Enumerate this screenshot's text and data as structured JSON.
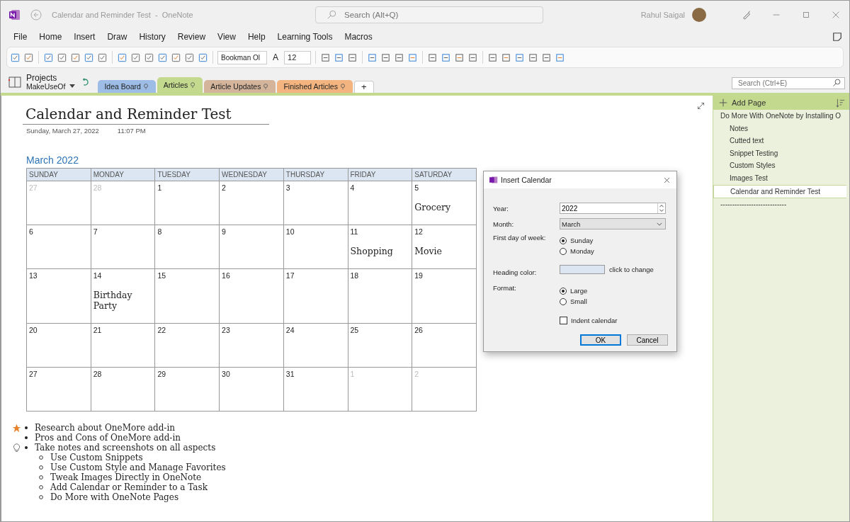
{
  "titlebar": {
    "title": "Calendar and Reminder Test  -  OneNote",
    "search_placeholder": "Search (Alt+Q)",
    "user": "Rahul Saigal"
  },
  "menu": [
    "File",
    "Home",
    "Insert",
    "Draw",
    "History",
    "Review",
    "View",
    "Help",
    "Learning Tools",
    "Macros"
  ],
  "toolbar": {
    "font": "Bookman Ol",
    "font_color_glyph": "A",
    "size": "12"
  },
  "notebook": {
    "group": "Projects",
    "name": "MakeUseOf"
  },
  "sections": [
    {
      "label": "Idea Board",
      "color": "#9dbde6",
      "selected": false
    },
    {
      "label": "Articles",
      "color": "#c3d98e",
      "selected": true
    },
    {
      "label": "Article Updates",
      "color": "#d4b59c",
      "selected": false
    },
    {
      "label": "Finished Articles",
      "color": "#f3b47f",
      "selected": false
    }
  ],
  "add_section": "+",
  "page_search": {
    "placeholder": "Search (Ctrl+E)"
  },
  "page": {
    "title": "Calendar and Reminder Test",
    "date": "Sunday, March 27, 2022",
    "time": "11:07 PM"
  },
  "calendar": {
    "heading": "March 2022",
    "weekdays": [
      "SUNDAY",
      "MONDAY",
      "TUESDAY",
      "WEDNESDAY",
      "THURSDAY",
      "FRIDAY",
      "SATURDAY"
    ],
    "weeks": [
      [
        {
          "day": "27",
          "outside": true
        },
        {
          "day": "28",
          "outside": true
        },
        {
          "day": "1",
          "outside": false
        },
        {
          "day": "2",
          "outside": false
        },
        {
          "day": "3",
          "outside": false
        },
        {
          "day": "4",
          "outside": false
        },
        {
          "day": "5",
          "outside": false,
          "event": "Grocery"
        }
      ],
      [
        {
          "day": "6",
          "outside": false
        },
        {
          "day": "7",
          "outside": false
        },
        {
          "day": "8",
          "outside": false
        },
        {
          "day": "9",
          "outside": false
        },
        {
          "day": "10",
          "outside": false
        },
        {
          "day": "11",
          "outside": false,
          "event": "Shopping"
        },
        {
          "day": "12",
          "outside": false,
          "event": "Movie"
        }
      ],
      [
        {
          "day": "13",
          "outside": false
        },
        {
          "day": "14",
          "outside": false,
          "event": "Birthday Party"
        },
        {
          "day": "15",
          "outside": false
        },
        {
          "day": "16",
          "outside": false
        },
        {
          "day": "17",
          "outside": false
        },
        {
          "day": "18",
          "outside": false
        },
        {
          "day": "19",
          "outside": false
        }
      ],
      [
        {
          "day": "20",
          "outside": false
        },
        {
          "day": "21",
          "outside": false
        },
        {
          "day": "22",
          "outside": false
        },
        {
          "day": "23",
          "outside": false
        },
        {
          "day": "24",
          "outside": false
        },
        {
          "day": "25",
          "outside": false
        },
        {
          "day": "26",
          "outside": false
        }
      ],
      [
        {
          "day": "27",
          "outside": false
        },
        {
          "day": "28",
          "outside": false
        },
        {
          "day": "29",
          "outside": false
        },
        {
          "day": "30",
          "outside": false
        },
        {
          "day": "31",
          "outside": false
        },
        {
          "day": "1",
          "outside": true
        },
        {
          "day": "2",
          "outside": true
        }
      ]
    ]
  },
  "notes": [
    {
      "text": "Research about OneMore add-in",
      "kind": "important"
    },
    {
      "text": "Pros and Cons of OneMore add-in",
      "kind": "plain"
    },
    {
      "text": "Take notes and screenshots on all aspects",
      "kind": "idea",
      "children": [
        {
          "text": "Use Custom Snippets"
        },
        {
          "text": "Use Custom Style and Manage Favorites"
        },
        {
          "text": "Tweak Images Directly in OneNote"
        },
        {
          "text": "Add Calendar or Reminder to a Task"
        },
        {
          "text": "Do More with OneNote Pages"
        }
      ]
    }
  ],
  "pages_pane": {
    "add_label": "Add Page",
    "pages": [
      {
        "title": "Do More With OneNote by Installing O",
        "selected": false,
        "children": [
          {
            "title": "Notes",
            "selected": false
          },
          {
            "title": "Cutted text",
            "selected": false
          },
          {
            "title": "Snippet Testing",
            "selected": false
          },
          {
            "title": "Custom Styles",
            "selected": false
          },
          {
            "title": "Images Test",
            "selected": false
          },
          {
            "title": "Calendar and Reminder Test",
            "selected": true
          }
        ]
      },
      {
        "title": "----------------------------",
        "selected": false
      }
    ]
  },
  "dialog": {
    "title": "Insert Calendar",
    "year_label": "Year:",
    "year": "2022",
    "month_label": "Month:",
    "month": "March",
    "first_day_label": "First day of week:",
    "first_day": [
      {
        "label": "Sunday",
        "selected": true
      },
      {
        "label": "Monday",
        "selected": false
      }
    ],
    "heading": {
      "label": "Heading color:",
      "color": "#dce6f2",
      "hint": "click to change"
    },
    "format_label": "Format:",
    "format": [
      {
        "label": "Large",
        "selected": true
      },
      {
        "label": "Small",
        "selected": false
      }
    ],
    "indent": {
      "label": "Indent calendar",
      "checked": false
    },
    "buttons": [
      {
        "label": "OK",
        "default": true
      },
      {
        "label": "Cancel",
        "default": false
      }
    ]
  }
}
